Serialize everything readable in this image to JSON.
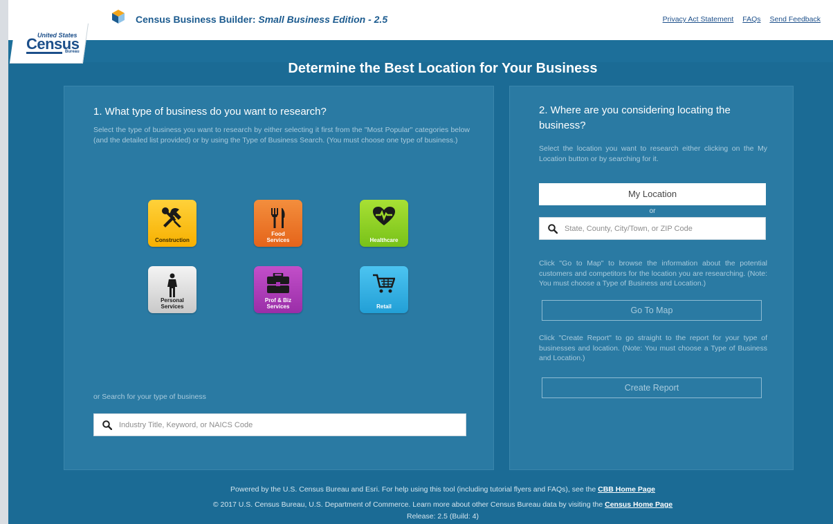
{
  "header": {
    "title_main": "Census Business Builder: ",
    "title_edition": "Small Business Edition - 2.5",
    "links": [
      "Privacy Act Statement",
      "FAQs",
      "Send Feedback"
    ],
    "logo": {
      "line1": "United States",
      "line2": "Census",
      "line3": "Bureau"
    }
  },
  "page_title": "Determine the Best Location for Your Business",
  "business_panel": {
    "heading": "1. What type of business do you want to research?",
    "description": "Select the type of business you want to research by either selecting it first from the \"Most Popular\" categories below (and the detailed list provided) or by using the Type of Business Search. (You must choose one type of business.)",
    "categories": [
      {
        "label_line1": "Construction",
        "label_line2": "",
        "icon": "tools-icon",
        "color": "#f7b000"
      },
      {
        "label_line1": "Food",
        "label_line2": "Services",
        "icon": "fork-knife-icon",
        "color": "#e5641a"
      },
      {
        "label_line1": "Healthcare",
        "label_line2": "",
        "icon": "heart-pulse-icon",
        "color": "#78c219"
      },
      {
        "label_line1": "Personal",
        "label_line2": "Services",
        "icon": "person-icon",
        "color": "#c9c9c9"
      },
      {
        "label_line1": "Prof & Biz",
        "label_line2": "Services",
        "icon": "briefcase-icon",
        "color": "#9a2ea8"
      },
      {
        "label_line1": "Retail",
        "label_line2": "",
        "icon": "cart-icon",
        "color": "#229fd6"
      }
    ],
    "search_label": "or Search for your type of business",
    "search_placeholder": "Industry Title, Keyword, or NAICS Code"
  },
  "location_panel": {
    "heading": "2. Where are you considering locating the business?",
    "description": "Select the location you want to research either clicking on the My Location button or by searching for it.",
    "my_location_label": "My Location",
    "or_label": "or",
    "search_placeholder": "State, County, City/Town, or ZIP Code",
    "map_description": "Click \"Go to Map\" to browse the information about the potential customers and competitors for the location you are researching. (Note: You must choose a Type of Business and Location.)",
    "map_button": "Go To Map",
    "report_description": "Click \"Create Report\" to go straight to the report for your type of businesses and location. (Note: You must choose a Type of Business and Location.)",
    "report_button": "Create Report"
  },
  "footer": {
    "line1_text": "Powered by the U.S. Census Bureau and Esri. For help using this tool (including tutorial flyers and FAQs), see the ",
    "line1_link": "CBB Home Page",
    "line2_text": "© 2017 U.S. Census Bureau, U.S. Department of Commerce. Learn more about other Census Bureau data by visiting the ",
    "line2_link": "Census Home Page",
    "line3_text": "Release: 2.5 (Build: 4)"
  },
  "colors": {
    "background": "#1b6b95",
    "panel": "#2a7aa3",
    "title_blue": "#1c5b8f"
  }
}
